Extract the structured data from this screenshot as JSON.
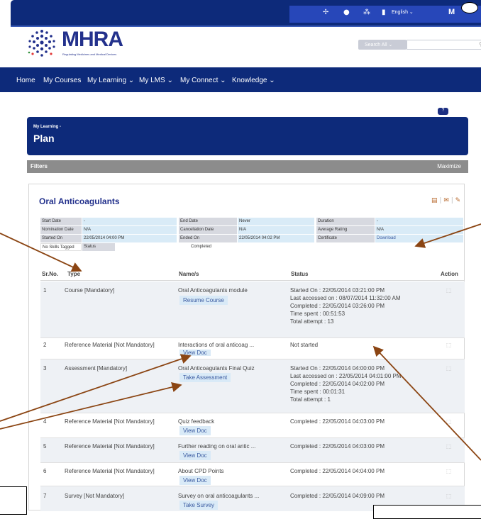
{
  "topbar": {
    "language": "English ⌄",
    "user_initial": "M",
    "chevron": "⌄"
  },
  "header": {
    "brand": "MHRA",
    "tagline": "Regulating Medicines and Medical Devices",
    "search_button": "Search All ⌄",
    "search_placeholder": ""
  },
  "nav": {
    "items": [
      "Home",
      "My Courses",
      "My Learning ⌄",
      "My LMS ⌄",
      "My Connect ⌄",
      "Knowledge ⌄"
    ]
  },
  "plan": {
    "breadcrumb": "My Learning -",
    "title": "Plan"
  },
  "filters": {
    "label": "Filters",
    "action": "Maximize"
  },
  "card": {
    "title": "Oral Anticoagulants",
    "info": {
      "start_date_label": "Start Date",
      "start_date": "-",
      "end_date_label": "End Date",
      "end_date": "Never",
      "duration_label": "Duration",
      "duration": "-",
      "nomination_label": "Nomination Date",
      "nomination": "N/A",
      "cancellation_label": "Cancellation Date",
      "cancellation": "N/A",
      "rating_label": "Average Rating",
      "rating": "N/A",
      "started_label": "Started On",
      "started": "22/05/2014 04:00 PM",
      "ended_label": "Ended On",
      "ended": "22/05/2014 04:02 PM",
      "certificate_label": "Certificate",
      "certificate": "Download",
      "skills": "No Skills Tagged",
      "status_label": "Status",
      "status": "Completed"
    },
    "columns": {
      "sr": "Sr.No.",
      "type": "Type",
      "names": "Name/s",
      "status": "Status",
      "action": "Action"
    },
    "rows": [
      {
        "sr": "1",
        "type": "Course [Mandatory]",
        "name": "Oral Anticoagulants module",
        "button": "Resume Course",
        "status": [
          "Started On : 22/05/2014 03:21:00 PM",
          "Last accessed on : 08/07/2014 11:32:00 AM",
          "Completed : 22/05/2014 03:26:00 PM",
          "Time spent : 00:51:53",
          "Total attempt : 13"
        ]
      },
      {
        "sr": "2",
        "type": "Reference Material [Not Mandatory]",
        "name": "Interactions of oral anticoag ...",
        "button": "View Doc",
        "status": [
          "Not started"
        ]
      },
      {
        "sr": "3",
        "type": "Assessment [Mandatory]",
        "name": "Oral Anticoagulants Final Quiz",
        "button": "Take Assessment",
        "status": [
          "Started On : 22/05/2014 04:00:00 PM",
          "Last accessed on : 22/05/2014 04:01:00 PM",
          "Completed : 22/05/2014 04:02:00 PM",
          "Time spent : 00:01:31",
          "Total attempt : 1"
        ]
      },
      {
        "sr": "4",
        "type": "Reference Material [Not Mandatory]",
        "name": "Quiz feedback",
        "button": "View Doc",
        "status": [
          "Completed : 22/05/2014 04:03:00 PM"
        ]
      },
      {
        "sr": "5",
        "type": "Reference Material [Not Mandatory]",
        "name": "Further reading on oral antic ...",
        "button": "View Doc",
        "status": [
          "Completed : 22/05/2014 04:03:00 PM"
        ]
      },
      {
        "sr": "6",
        "type": "Reference Material [Not Mandatory]",
        "name": "About CPD Points",
        "button": "View Doc",
        "status": [
          "Completed : 22/05/2014 04:04:00 PM"
        ]
      },
      {
        "sr": "7",
        "type": "Survey [Not Mandatory]",
        "name": "Survey on oral anticoagulants ...",
        "button": "Take Survey",
        "status": [
          "Completed : 22/05/2014 04:09:00 PM"
        ]
      }
    ]
  },
  "colors": {
    "navy": "#0d2a7a",
    "brand_blue": "#23318c",
    "callout_arrow": "#8b4513"
  },
  "icons": [
    "microphone-icon",
    "chat-icon",
    "network-icon",
    "mobile-icon",
    "search-icon",
    "help-icon",
    "print-icon",
    "email-icon",
    "comments-icon",
    "action-icon"
  ]
}
